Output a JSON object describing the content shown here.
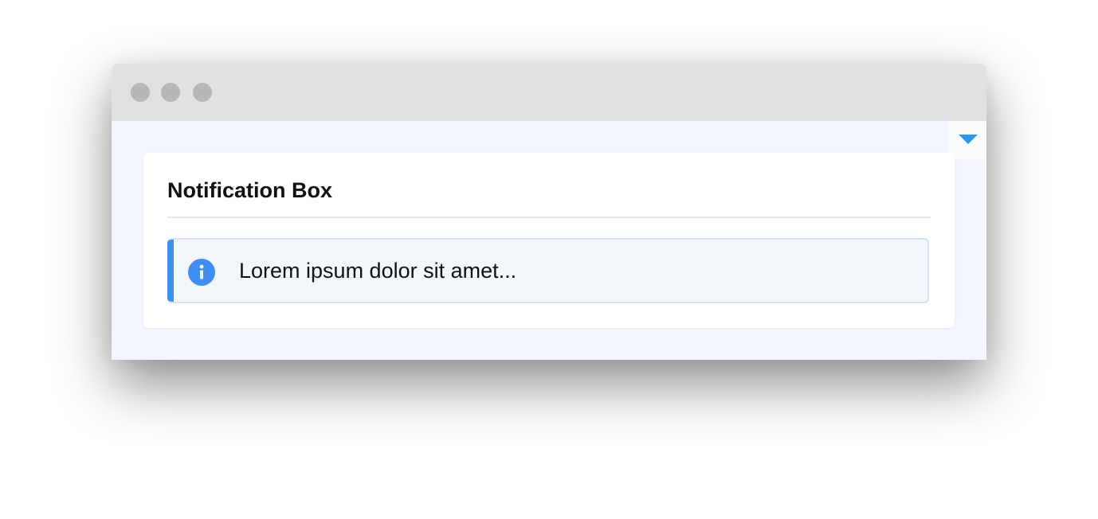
{
  "window": {
    "controls": [
      "close",
      "minimize",
      "maximize"
    ]
  },
  "dropdown": {
    "icon": "caret-down-icon",
    "color": "#2d95f5"
  },
  "card": {
    "title": "Notification Box",
    "notification": {
      "type": "info",
      "icon": "info-icon",
      "message": "Lorem ipsum dolor sit amet...",
      "accent_color": "#3e8ef7",
      "background_color": "#f3f7fb",
      "border_color": "#d4e3f3"
    }
  }
}
